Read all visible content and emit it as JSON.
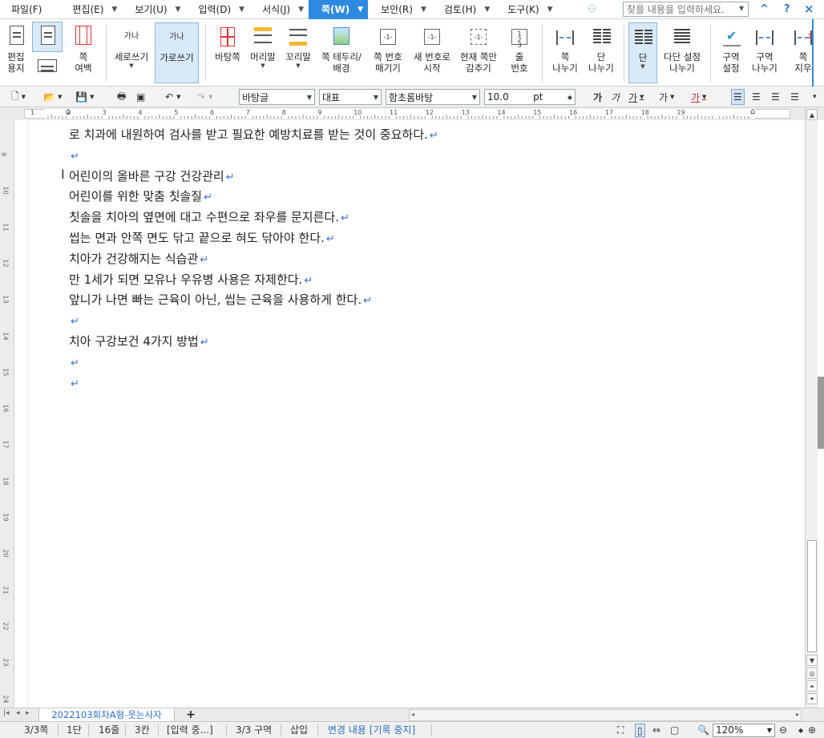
{
  "menu": [
    {
      "label": "파일(F)",
      "active": false
    },
    {
      "label": "편집(E)",
      "active": false
    },
    {
      "label": "보기(U)",
      "active": false
    },
    {
      "label": "입력(D)",
      "active": false
    },
    {
      "label": "서식(J)",
      "active": false
    },
    {
      "label": "쪽(W)",
      "active": true
    },
    {
      "label": "보안(R)",
      "active": false
    },
    {
      "label": "검토(H)",
      "active": false
    },
    {
      "label": "도구(K)",
      "active": false
    }
  ],
  "search": {
    "placeholder": "찾을 내용을 입력하세요."
  },
  "window_controls": {
    "up": "^",
    "help": "?",
    "close": "×"
  },
  "ribbon": {
    "edit_paper": "편집\n용지",
    "page_margin": "쪽\n여백",
    "vertical_write": "세로쓰기",
    "horizontal_write": "가로쓰기",
    "background_page": "바탕쪽",
    "header": "머리말",
    "footer": "꼬리말",
    "border_bg": "쪽 테두리/\n배경",
    "page_number": "쪽 번호\n매기기",
    "new_number": "새 번호로\n시작",
    "hide_current": "현재 쪽만\n감추기",
    "line_number": "줄\n번호",
    "page_break": "쪽\n나누기",
    "column_break": "단\n나누기",
    "columns": "단",
    "multi_column": "다단 설정\n나누기",
    "section_setup": "구역\n설정",
    "section_break": "구역\n나누기",
    "page_delete": "쪽\n지우"
  },
  "toolbar2": {
    "style": "바탕글",
    "lang": "대표",
    "font": "함초롬바탕",
    "size": "10.0",
    "unit": "pt"
  },
  "ruler_numbers": [
    "1",
    "2",
    "3",
    "4",
    "5",
    "6",
    "7",
    "8",
    "9",
    "10",
    "11",
    "12",
    "13",
    "14",
    "15",
    "16",
    "17",
    "18",
    "19"
  ],
  "vruler_numbers": [
    "9",
    "10",
    "11",
    "12",
    "13",
    "14",
    "15",
    "16",
    "17",
    "18",
    "19",
    "20",
    "21",
    "22",
    "23",
    "24"
  ],
  "document": {
    "lines": [
      "로 치과에 내원하여 검사를 받고 필요한 예방치료를 받는 것이 중요하다.",
      "",
      "어린이의 올바른 구강 건강관리",
      "어린이를 위한 맞춤 칫솔질",
      "칫솔을 치아의 옆면에 대고 수편으로 좌우를 문지른다.",
      "씹는 면과 안쪽 면도 닦고 끝으로 혀도 닦아야 한다.",
      "치아가 건강해지는 식습관",
      "만 1세가 되면 모유나 우유병 사용은 자제한다.",
      "앞니가 나면 빠는 근육이 아닌, 씹는 근육을 사용하게 한다.",
      "",
      "치아 구강보건 4가지 방법",
      "",
      ""
    ],
    "paragraph_mark": "↵"
  },
  "tabs": {
    "doc_name": "2022103회차A형-웃는사자",
    "add": "+"
  },
  "status": {
    "page": "3/3쪽",
    "column": "1단",
    "line": "16줄",
    "col": "3칸",
    "input_mode": "[입력 중...]",
    "section": "3/3 구역",
    "insert": "삽입",
    "track": "변경 내용 [기록 중지]",
    "zoom": "120%"
  },
  "colors": {
    "accent": "#2d8ae0",
    "paragraph_mark": "#3a6fd0",
    "tab_text": "#2b6fc4"
  }
}
